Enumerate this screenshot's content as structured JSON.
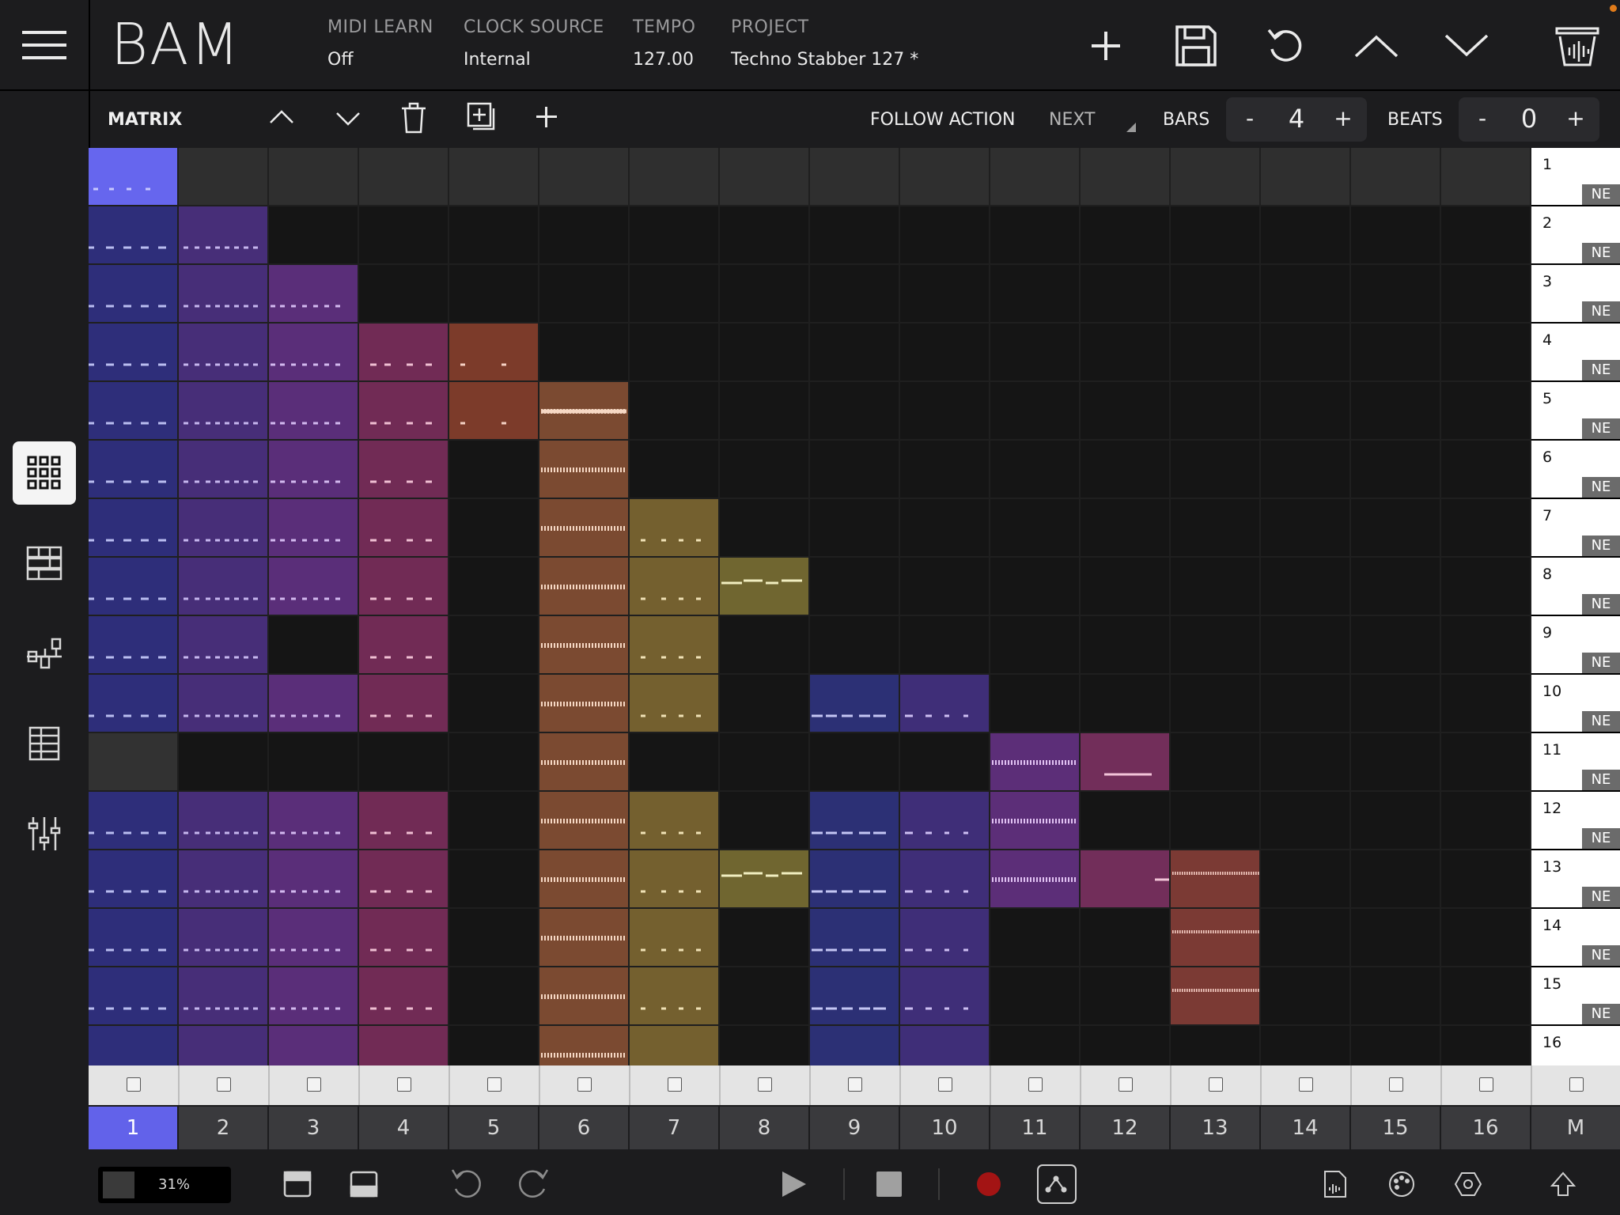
{
  "app": {
    "logo": "BAM"
  },
  "header": {
    "midi_learn": {
      "label": "MIDI LEARN",
      "value": "Off"
    },
    "clock_source": {
      "label": "CLOCK SOURCE",
      "value": "Internal"
    },
    "tempo": {
      "label": "TEMPO",
      "value": "127.00"
    },
    "project": {
      "label": "PROJECT",
      "value": "Techno Stabber 127 *"
    },
    "icons": [
      "add-icon",
      "save-icon",
      "undo-icon",
      "chevron-up-icon",
      "chevron-down-icon",
      "trash-basket-icon"
    ]
  },
  "sidebar": {
    "items": [
      "matrix-grid-icon",
      "sequencer-icon",
      "mixer-routing-icon",
      "list-icon",
      "sliders-icon"
    ],
    "active": "matrix-grid-icon"
  },
  "matrix_toolbar": {
    "title": "MATRIX",
    "follow_action_label": "FOLLOW ACTION",
    "follow_action_value": "NEXT",
    "bars": {
      "label": "BARS",
      "minus": "-",
      "value": "4",
      "plus": "+"
    },
    "beats": {
      "label": "BEATS",
      "minus": "-",
      "value": "0",
      "plus": "+"
    }
  },
  "colors": {
    "t1": "#2e2e7a",
    "t2": "#472e78",
    "t3": "#5a2e79",
    "t4": "#712b55",
    "t5": "#7c3b2a",
    "t6": "#7b4a31",
    "t7": "#74602f",
    "t8": "#706630",
    "t9": "#2c3075",
    "t10": "#3f2e78",
    "t11": "#5c2e78",
    "t12": "#722e5a",
    "t13": "#7b3a34",
    "selected": "#6666ee",
    "empty_top": "#2f2f2f",
    "empty": "#151515",
    "stop_gray": "#323232",
    "accent": "#6262ea",
    "record": "#9b1414"
  },
  "clip_matrix": [
    [
      "S",
      "T",
      "T",
      "T",
      "T",
      "T",
      "T",
      "T",
      "T",
      "T",
      "T",
      "T",
      "T",
      "T",
      "T",
      "T"
    ],
    [
      "1",
      "2",
      "",
      "",
      "",
      "",
      "",
      "",
      "",
      "",
      "",
      "",
      "",
      "",
      "",
      ""
    ],
    [
      "1",
      "2",
      "3",
      "",
      "",
      "",
      "",
      "",
      "",
      "",
      "",
      "",
      "",
      "",
      "",
      ""
    ],
    [
      "1",
      "2",
      "3",
      "4",
      "5",
      "",
      "",
      "",
      "",
      "",
      "",
      "",
      "",
      "",
      "",
      ""
    ],
    [
      "1",
      "2",
      "3",
      "4",
      "5",
      "6",
      "",
      "",
      "",
      "",
      "",
      "",
      "",
      "",
      "",
      ""
    ],
    [
      "1",
      "2",
      "3",
      "4",
      "",
      "6",
      "",
      "",
      "",
      "",
      "",
      "",
      "",
      "",
      "",
      ""
    ],
    [
      "1",
      "2",
      "3",
      "4",
      "",
      "6",
      "7",
      "",
      "",
      "",
      "",
      "",
      "",
      "",
      "",
      ""
    ],
    [
      "1",
      "2",
      "3",
      "4",
      "",
      "6",
      "7",
      "8",
      "",
      "",
      "",
      "",
      "",
      "",
      "",
      ""
    ],
    [
      "1",
      "2",
      "",
      "4",
      "",
      "6",
      "7",
      "",
      "",
      "",
      "",
      "",
      "",
      "",
      "",
      ""
    ],
    [
      "1",
      "2",
      "3",
      "4",
      "",
      "6",
      "7",
      "",
      "9",
      "10",
      "",
      "",
      "",
      "",
      "",
      ""
    ],
    [
      "G",
      "",
      "",
      "",
      "",
      "6",
      "",
      "",
      "",
      "",
      "11",
      "12",
      "",
      "",
      "",
      ""
    ],
    [
      "1",
      "2",
      "3",
      "4",
      "",
      "6",
      "7",
      "",
      "9",
      "10",
      "11",
      "",
      "",
      "",
      "",
      ""
    ],
    [
      "1",
      "2",
      "3",
      "4",
      "",
      "6",
      "7",
      "8",
      "9",
      "10",
      "11",
      "12",
      "13",
      "",
      "",
      ""
    ],
    [
      "1",
      "2",
      "3",
      "4",
      "",
      "6",
      "7",
      "",
      "9",
      "10",
      "",
      "",
      "13",
      "",
      "",
      ""
    ],
    [
      "1",
      "2",
      "3",
      "4",
      "",
      "6",
      "7",
      "",
      "9",
      "10",
      "",
      "",
      "13",
      "",
      "",
      ""
    ],
    [
      "1",
      "2",
      "3",
      "4",
      "",
      "6",
      "7",
      "",
      "9",
      "10",
      "",
      "",
      "",
      "",
      "",
      ""
    ]
  ],
  "scenes": [
    {
      "n": "1",
      "fa": "NE"
    },
    {
      "n": "2",
      "fa": "NE"
    },
    {
      "n": "3",
      "fa": "NE"
    },
    {
      "n": "4",
      "fa": "NE"
    },
    {
      "n": "5",
      "fa": "NE"
    },
    {
      "n": "6",
      "fa": "NE"
    },
    {
      "n": "7",
      "fa": "NE"
    },
    {
      "n": "8",
      "fa": "NE"
    },
    {
      "n": "9",
      "fa": "NE"
    },
    {
      "n": "10",
      "fa": "NE"
    },
    {
      "n": "11",
      "fa": "NE"
    },
    {
      "n": "12",
      "fa": "NE"
    },
    {
      "n": "13",
      "fa": "NE"
    },
    {
      "n": "14",
      "fa": "NE"
    },
    {
      "n": "15",
      "fa": "NE"
    },
    {
      "n": "16",
      "fa": ""
    }
  ],
  "tracks": [
    "1",
    "2",
    "3",
    "4",
    "5",
    "6",
    "7",
    "8",
    "9",
    "10",
    "11",
    "12",
    "13",
    "14",
    "15",
    "16",
    "M"
  ],
  "active_track": "1",
  "bottom": {
    "cpu": "31%",
    "icons": [
      "window-top-icon",
      "window-bottom-icon",
      "undo-icon",
      "redo-icon",
      "play-icon",
      "stop-icon",
      "record-icon",
      "automation-icon",
      "export-file-icon",
      "palette-icon",
      "hexagon-settings-icon",
      "upload-icon"
    ]
  }
}
